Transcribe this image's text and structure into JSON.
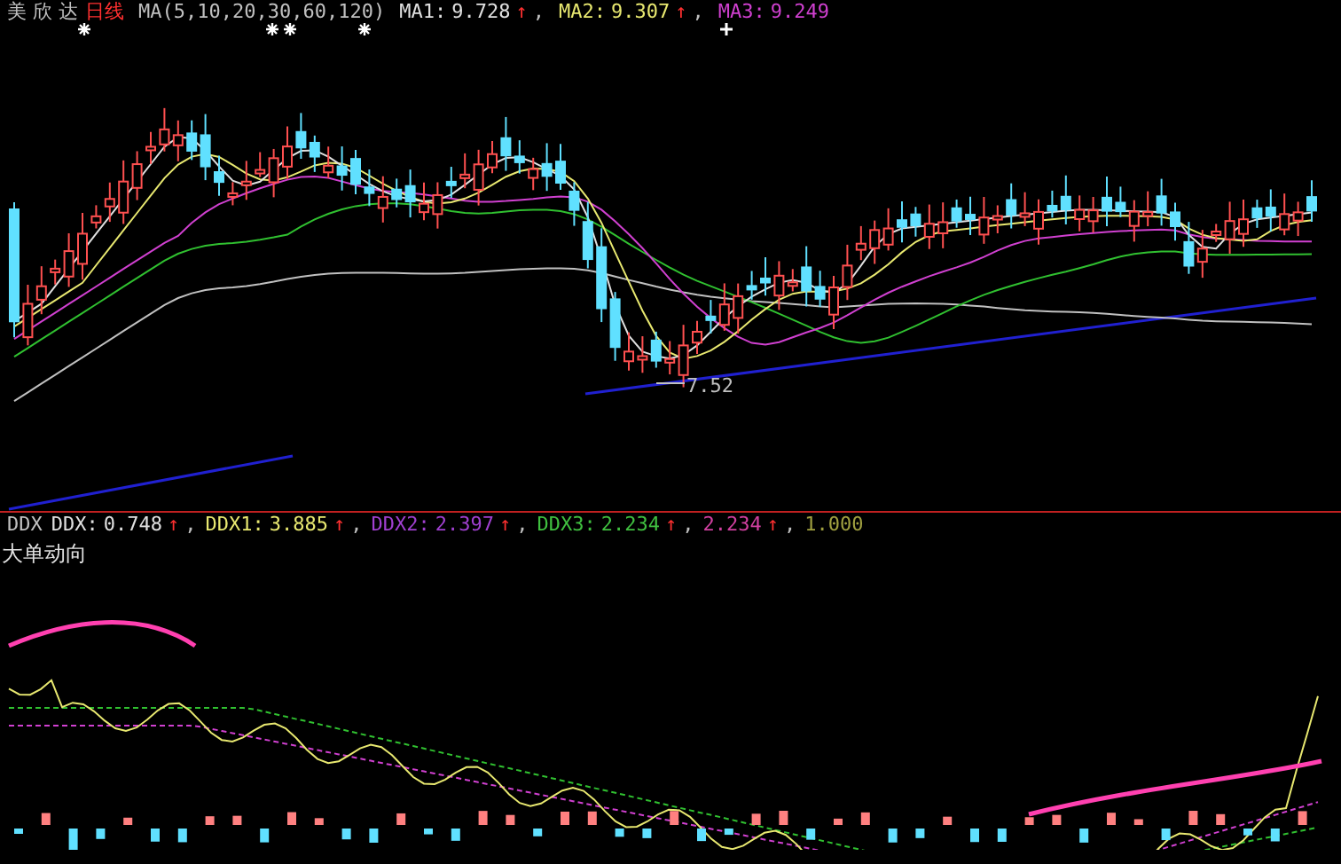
{
  "header": {
    "name": "美 欣 达",
    "period": "日线",
    "ma_label": "MA(5,10,20,30,60,120)",
    "readings": [
      {
        "label": "MA1:",
        "value": "9.728",
        "arrow": "↑",
        "sep": ",",
        "color": "#e0e0e0"
      },
      {
        "label": "MA2:",
        "value": "9.307",
        "arrow": "↑",
        "sep": ",",
        "color": "#e8e870"
      },
      {
        "label": "MA3:",
        "value": "9.249",
        "color": "#d040d0"
      }
    ]
  },
  "price_chart": {
    "low_label": "7.52"
  },
  "ddx_panel": {
    "name": "DDX",
    "title": "大单动向",
    "readings": [
      {
        "label": "DDX:",
        "value": "0.748",
        "arrow": "↑",
        "sep": ",",
        "color": "#e0e0e0"
      },
      {
        "label": "DDX1:",
        "value": "3.885",
        "arrow": "↑",
        "sep": ",",
        "color": "#e8e870"
      },
      {
        "label": "DDX2:",
        "value": "2.397",
        "arrow": "↑",
        "sep": ",",
        "color": "#a040d0"
      },
      {
        "label": "DDX3:",
        "value": "2.234",
        "arrow": "↑",
        "sep": ",",
        "color": "#40c040"
      },
      {
        "value": "2.234",
        "arrow": "↑",
        "sep": ",",
        "color": "#d040a0"
      },
      {
        "value": "1.000",
        "color": "#a0a040"
      }
    ]
  }
}
